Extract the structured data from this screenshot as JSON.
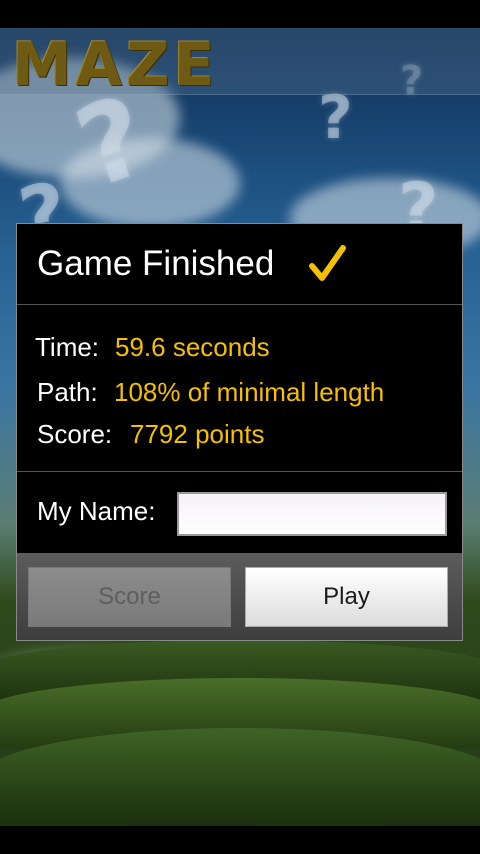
{
  "app": {
    "title": "MAZE"
  },
  "dialog": {
    "title": "Game Finished",
    "check_icon": "checkmark-icon",
    "stats": {
      "time_label": "Time:",
      "time_value": "59.6 seconds",
      "path_label": "Path:",
      "path_value": "108% of minimal length",
      "score_label": "Score:",
      "score_value": "7792 points"
    },
    "name_label": "My Name:",
    "name_value": "",
    "name_placeholder": "",
    "buttons": {
      "score": "Score",
      "play": "Play"
    }
  },
  "colors": {
    "accent": "#f4c000",
    "title": "#6e5a12"
  }
}
